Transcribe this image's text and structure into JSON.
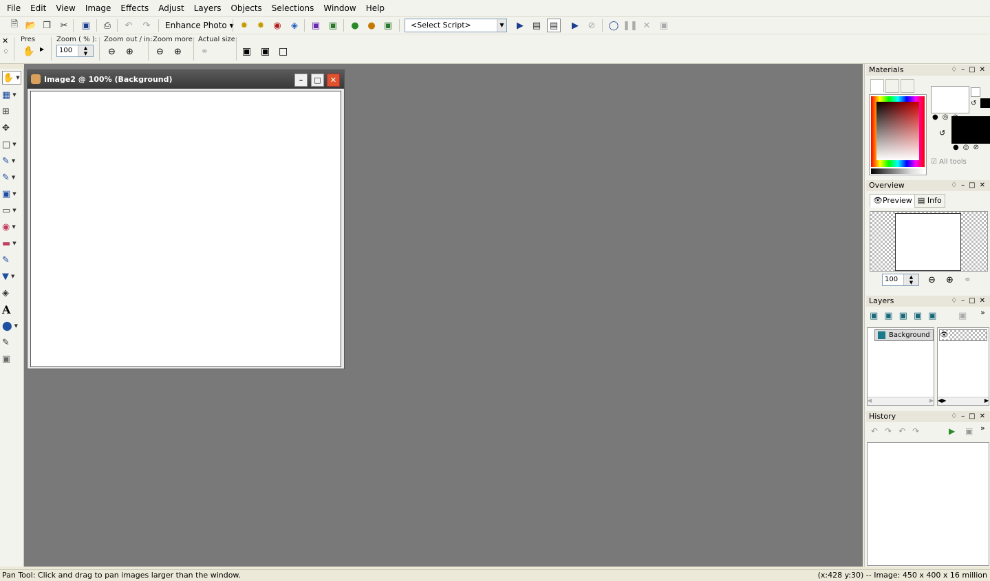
{
  "menu": [
    "File",
    "Edit",
    "View",
    "Image",
    "Effects",
    "Adjust",
    "Layers",
    "Objects",
    "Selections",
    "Window",
    "Help"
  ],
  "toolbar": {
    "enhance_label": "Enhance Photo",
    "script_select": "<Select Script>"
  },
  "tool_options": {
    "presets_label": "Pres",
    "zoom_label": "Zoom ( % ):",
    "zoom_value": "100",
    "zoom_out_in_label": "Zoom out / in:",
    "zoom_more_label": "Zoom more:",
    "actual_size_label": "Actual size:"
  },
  "image_window": {
    "title": "Image2 @ 100% (Background)"
  },
  "panels": {
    "materials": {
      "title": "Materials",
      "all_tools_label": "All tools",
      "foreground_color": "#ffffff",
      "background_color": "#000000"
    },
    "overview": {
      "title": "Overview",
      "tab_preview": "Preview",
      "tab_info": "Info",
      "zoom_value": "100"
    },
    "layers": {
      "title": "Layers",
      "layer_name": "Background"
    },
    "history": {
      "title": "History"
    }
  },
  "status": {
    "left": "Pan Tool: Click and drag to pan images larger than the window.",
    "right": "(x:428 y:30) -- Image:  450 x 400 x 16 million"
  },
  "colors": {
    "workspace": "#797979",
    "title_gradient_top": "#5a5a5a",
    "close_button": "#e0522d"
  }
}
